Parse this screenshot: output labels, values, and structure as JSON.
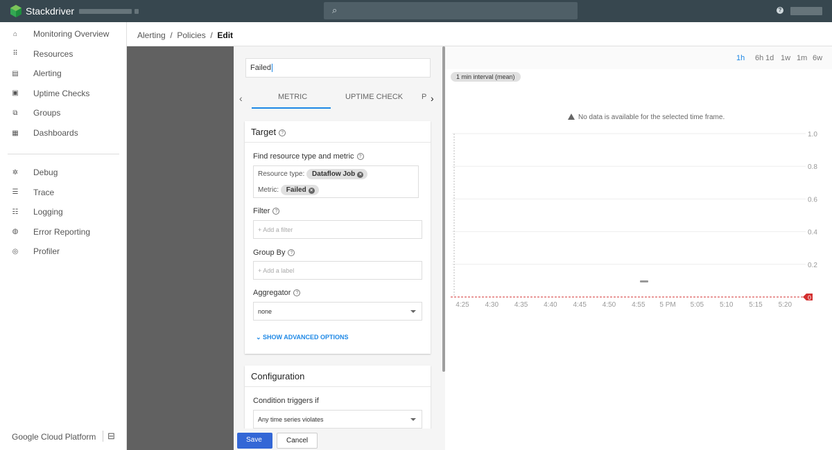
{
  "topbar": {
    "brand": "Stackdriver",
    "search_icon": "search-icon",
    "help_icon": "help-icon"
  },
  "sidebar": {
    "items": [
      {
        "label": "Monitoring Overview",
        "icon": "home-icon",
        "glyph": "⌂"
      },
      {
        "label": "Resources",
        "icon": "grid-icon",
        "glyph": "⠿"
      },
      {
        "label": "Alerting",
        "icon": "alert-icon",
        "glyph": "▤"
      },
      {
        "label": "Uptime Checks",
        "icon": "monitor-icon",
        "glyph": "▣"
      },
      {
        "label": "Groups",
        "icon": "groups-icon",
        "glyph": "⧉"
      },
      {
        "label": "Dashboards",
        "icon": "dashboard-icon",
        "glyph": "▦"
      }
    ],
    "items2": [
      {
        "label": "Debug",
        "icon": "debug-icon",
        "glyph": "✲"
      },
      {
        "label": "Trace",
        "icon": "trace-icon",
        "glyph": "☰"
      },
      {
        "label": "Logging",
        "icon": "logging-icon",
        "glyph": "☷"
      },
      {
        "label": "Error Reporting",
        "icon": "error-icon",
        "glyph": "◍"
      },
      {
        "label": "Profiler",
        "icon": "profiler-icon",
        "glyph": "◎"
      }
    ],
    "footer": "Google Cloud Platform"
  },
  "breadcrumb": {
    "a": "Alerting",
    "b": "Policies",
    "c": "Edit"
  },
  "editor": {
    "name_value": "Failed",
    "tabs": [
      "METRIC",
      "UPTIME CHECK",
      "P"
    ],
    "target": {
      "title": "Target",
      "find_label": "Find resource type and metric",
      "resource_label": "Resource type:",
      "resource_value": "Dataflow Job",
      "metric_label": "Metric:",
      "metric_value": "Failed",
      "filter_label": "Filter",
      "filter_placeholder": "+ Add a filter",
      "groupby_label": "Group By",
      "groupby_placeholder": "+ Add a label",
      "aggregator_label": "Aggregator",
      "aggregator_value": "none",
      "advanced": "SHOW ADVANCED OPTIONS"
    },
    "config": {
      "title": "Configuration",
      "trigger_label": "Condition triggers if",
      "trigger_value": "Any time series violates"
    },
    "save": "Save",
    "cancel": "Cancel"
  },
  "chart": {
    "ranges": [
      "1h",
      "6h",
      "1d",
      "1w",
      "1m",
      "6w"
    ],
    "selected_range": "1h",
    "interval": "1 min interval (mean)",
    "message": "No data is available for the selected time frame.",
    "threshold_label": "0",
    "accent": "#1e88e5",
    "threshold_color": "#d32f2f"
  },
  "chart_data": {
    "type": "line",
    "x_ticks": [
      "4:25",
      "4:30",
      "4:35",
      "4:40",
      "4:45",
      "4:50",
      "4:55",
      "5 PM",
      "5:05",
      "5:10",
      "5:15",
      "5:20"
    ],
    "y_ticks": [
      "1.0",
      "0.8",
      "0.6",
      "0.4",
      "0.2"
    ],
    "ylim": [
      0,
      1
    ],
    "threshold": 0,
    "series": []
  }
}
